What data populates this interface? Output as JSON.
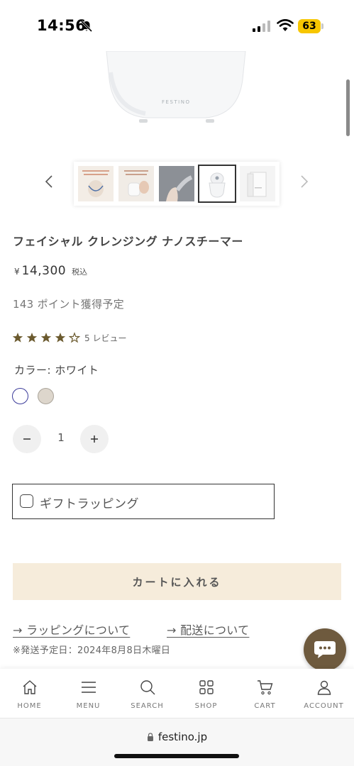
{
  "status_bar": {
    "time": "14:56",
    "battery": "63"
  },
  "product": {
    "title": "フェイシャル クレンジング ナノスチーマー",
    "price_yen": "¥",
    "price": "14,300",
    "tax_label": "税込",
    "points": "143 ポイント獲得予定",
    "rating": 4,
    "review_count": "5 レビュー",
    "color_label": "カラー: ホワイト",
    "colors": [
      "#ffffff",
      "#ddd6cc"
    ],
    "quantity": "1"
  },
  "thumbnails": {
    "count": 5,
    "active_index": 3
  },
  "gift": {
    "label": "ギフトラッピング"
  },
  "cart_button": "カートに入れる",
  "links": {
    "wrapping": "→ ラッピングについて",
    "shipping": "→ 配送について"
  },
  "ship_date": "※発送予定日：2024年8月8日木曜日",
  "nav": {
    "items": [
      {
        "label": "HOME",
        "icon": "home-icon"
      },
      {
        "label": "MENU",
        "icon": "menu-icon"
      },
      {
        "label": "SEARCH",
        "icon": "search-icon"
      },
      {
        "label": "SHOP",
        "icon": "grid-icon"
      },
      {
        "label": "CART",
        "icon": "cart-icon"
      },
      {
        "label": "ACCOUNT",
        "icon": "user-icon"
      }
    ]
  },
  "browser": {
    "url": "festino.jp"
  },
  "colors": {
    "accent": "#f6ecdb",
    "chat": "#6e5a3e",
    "star": "#6b5a2e"
  }
}
